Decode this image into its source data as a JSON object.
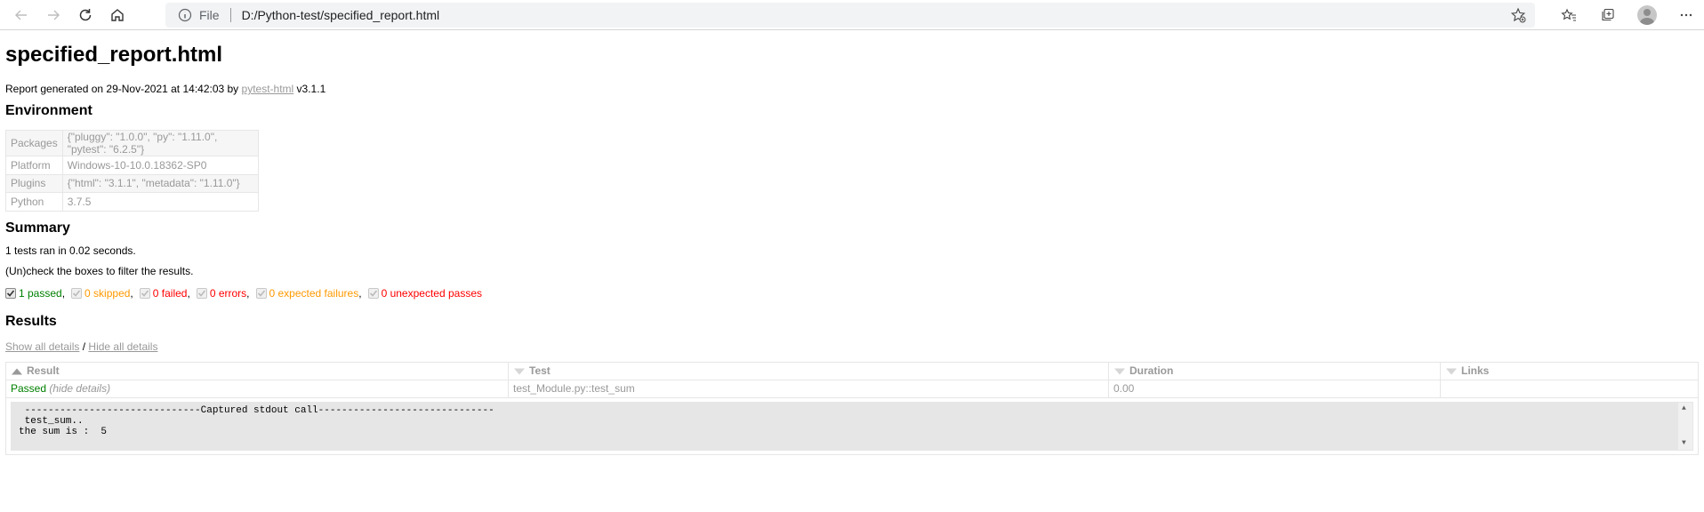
{
  "browser": {
    "address_label": "File",
    "url": "D:/Python-test/specified_report.html"
  },
  "report": {
    "title": "specified_report.html",
    "generated_prefix": "Report generated on 29-Nov-2021 at 14:42:03 by ",
    "generated_link": "pytest-html",
    "generated_suffix": " v3.1.1",
    "environment_heading": "Environment",
    "environment": [
      {
        "key": "Packages",
        "value": "{\"pluggy\": \"1.0.0\", \"py\": \"1.11.0\", \"pytest\": \"6.2.5\"}"
      },
      {
        "key": "Platform",
        "value": "Windows-10-10.0.18362-SP0"
      },
      {
        "key": "Plugins",
        "value": "{\"html\": \"3.1.1\", \"metadata\": \"1.11.0\"}"
      },
      {
        "key": "Python",
        "value": "3.7.5"
      }
    ],
    "summary_heading": "Summary",
    "summary_text": "1 tests ran in 0.02 seconds.",
    "filter_hint": "(Un)check the boxes to filter the results.",
    "filters": {
      "passed": "1 passed",
      "skipped": "0 skipped",
      "failed": "0 failed",
      "errors": "0 errors",
      "xfailed": "0 expected failures",
      "xpassed": "0 unexpected passes"
    },
    "results_heading": "Results",
    "show_all": "Show all details",
    "slash": " / ",
    "hide_all": "Hide all details",
    "columns": {
      "result": "Result",
      "test": "Test",
      "duration": "Duration",
      "links": "Links"
    },
    "row": {
      "result": "Passed",
      "hide_details": "(hide details)",
      "test": "test_Module.py::test_sum",
      "duration": "0.00",
      "links": ""
    },
    "log": " ------------------------------Captured stdout call------------------------------\n test_sum..\nthe sum is :  5"
  },
  "colors": {
    "passed": "#008000",
    "skipped": "#ff9900",
    "failed": "#ff0000",
    "muted": "#999999"
  }
}
